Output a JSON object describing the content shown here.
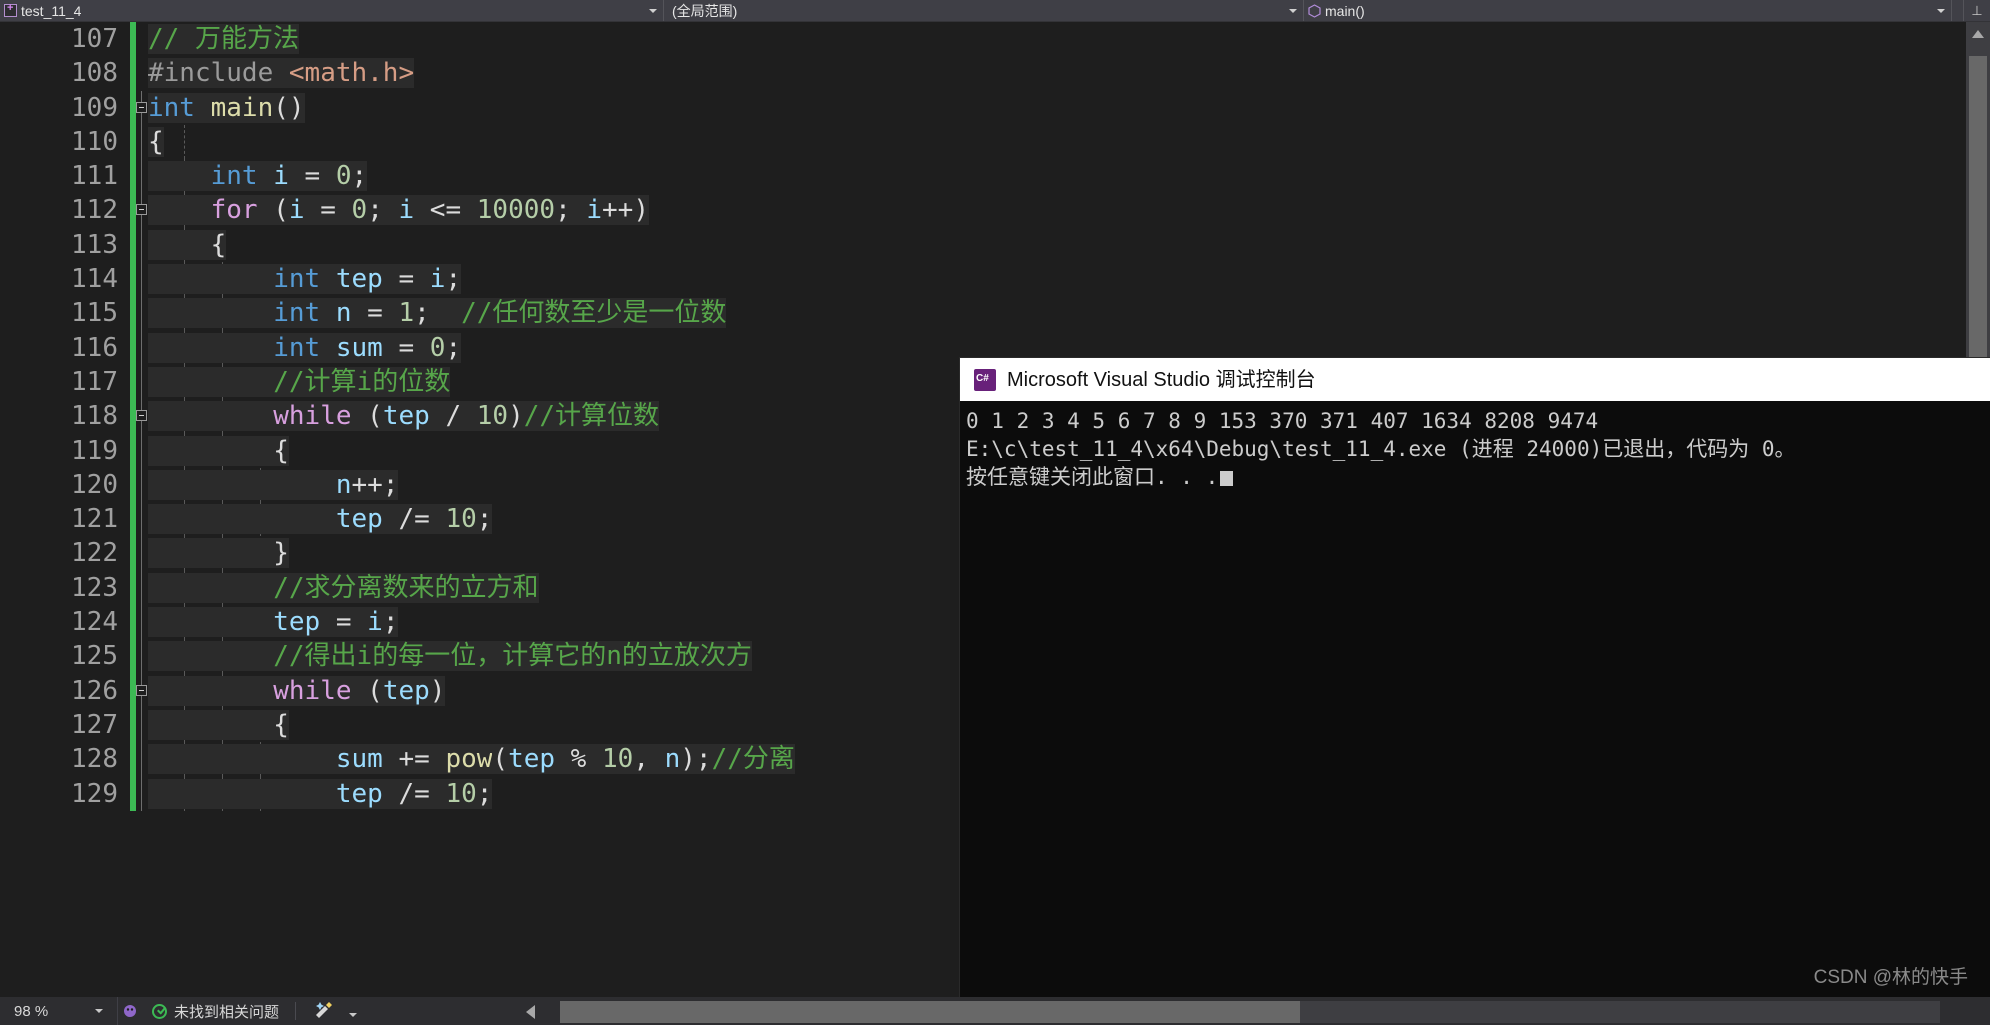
{
  "navbar": {
    "project_combo": {
      "label": "test_11_4",
      "icon": "file-cs-icon"
    },
    "scope_combo": {
      "label": "(全局范围)"
    },
    "member_combo": {
      "label": "main()",
      "icon": "method-icon"
    },
    "split_icon": "split-window-down-icon"
  },
  "editor": {
    "first_line_number": 107,
    "lines": [
      {
        "num": "107",
        "fold": "none",
        "tokens": [
          {
            "t": "// 万能方法",
            "c": "t-com"
          }
        ]
      },
      {
        "num": "108",
        "fold": "none",
        "tokens": [
          {
            "t": "#include ",
            "c": "t-pre"
          },
          {
            "t": "<math.h>",
            "c": "t-str"
          }
        ]
      },
      {
        "num": "109",
        "fold": "minus",
        "tokens": [
          {
            "t": "int ",
            "c": "t-key"
          },
          {
            "t": "main",
            "c": "t-fn"
          },
          {
            "t": "()",
            "c": "t-pln"
          }
        ]
      },
      {
        "num": "110",
        "fold": "none",
        "tokens": [
          {
            "t": "{",
            "c": "t-pln"
          }
        ]
      },
      {
        "num": "111",
        "fold": "none",
        "tokens": [
          {
            "t": "    ",
            "c": "t-pln"
          },
          {
            "t": "int ",
            "c": "t-key"
          },
          {
            "t": "i",
            "c": "t-var"
          },
          {
            "t": " = ",
            "c": "t-pln"
          },
          {
            "t": "0",
            "c": "t-num"
          },
          {
            "t": ";",
            "c": "t-pln"
          }
        ]
      },
      {
        "num": "112",
        "fold": "minus",
        "tokens": [
          {
            "t": "    ",
            "c": "t-pln"
          },
          {
            "t": "for",
            "c": "t-ctl"
          },
          {
            "t": " (",
            "c": "t-pln"
          },
          {
            "t": "i",
            "c": "t-var"
          },
          {
            "t": " = ",
            "c": "t-pln"
          },
          {
            "t": "0",
            "c": "t-num"
          },
          {
            "t": "; ",
            "c": "t-pln"
          },
          {
            "t": "i",
            "c": "t-var"
          },
          {
            "t": " <= ",
            "c": "t-pln"
          },
          {
            "t": "10000",
            "c": "t-num"
          },
          {
            "t": "; ",
            "c": "t-pln"
          },
          {
            "t": "i",
            "c": "t-var"
          },
          {
            "t": "++)",
            "c": "t-pln"
          }
        ]
      },
      {
        "num": "113",
        "fold": "none",
        "tokens": [
          {
            "t": "    {",
            "c": "t-pln"
          }
        ]
      },
      {
        "num": "114",
        "fold": "none",
        "tokens": [
          {
            "t": "        ",
            "c": "t-pln"
          },
          {
            "t": "int ",
            "c": "t-key"
          },
          {
            "t": "tep",
            "c": "t-var"
          },
          {
            "t": " = ",
            "c": "t-pln"
          },
          {
            "t": "i",
            "c": "t-var"
          },
          {
            "t": ";",
            "c": "t-pln"
          }
        ]
      },
      {
        "num": "115",
        "fold": "none",
        "tokens": [
          {
            "t": "        ",
            "c": "t-pln"
          },
          {
            "t": "int ",
            "c": "t-key"
          },
          {
            "t": "n",
            "c": "t-var"
          },
          {
            "t": " = ",
            "c": "t-pln"
          },
          {
            "t": "1",
            "c": "t-num"
          },
          {
            "t": ";  ",
            "c": "t-pln"
          },
          {
            "t": "//任何数至少是一位数",
            "c": "t-com"
          }
        ]
      },
      {
        "num": "116",
        "fold": "none",
        "tokens": [
          {
            "t": "        ",
            "c": "t-pln"
          },
          {
            "t": "int ",
            "c": "t-key"
          },
          {
            "t": "sum",
            "c": "t-var"
          },
          {
            "t": " = ",
            "c": "t-pln"
          },
          {
            "t": "0",
            "c": "t-num"
          },
          {
            "t": ";",
            "c": "t-pln"
          }
        ]
      },
      {
        "num": "117",
        "fold": "none",
        "tokens": [
          {
            "t": "        ",
            "c": "t-pln"
          },
          {
            "t": "//计算i的位数",
            "c": "t-com"
          }
        ]
      },
      {
        "num": "118",
        "fold": "minus",
        "tokens": [
          {
            "t": "        ",
            "c": "t-pln"
          },
          {
            "t": "while",
            "c": "t-ctl"
          },
          {
            "t": " (",
            "c": "t-pln"
          },
          {
            "t": "tep",
            "c": "t-var"
          },
          {
            "t": " / ",
            "c": "t-pln"
          },
          {
            "t": "10",
            "c": "t-num"
          },
          {
            "t": ")",
            "c": "t-pln"
          },
          {
            "t": "//计算位数",
            "c": "t-com"
          }
        ]
      },
      {
        "num": "119",
        "fold": "none",
        "tokens": [
          {
            "t": "        {",
            "c": "t-pln"
          }
        ]
      },
      {
        "num": "120",
        "fold": "none",
        "tokens": [
          {
            "t": "            ",
            "c": "t-pln"
          },
          {
            "t": "n",
            "c": "t-var"
          },
          {
            "t": "++;",
            "c": "t-pln"
          }
        ]
      },
      {
        "num": "121",
        "fold": "none",
        "tokens": [
          {
            "t": "            ",
            "c": "t-pln"
          },
          {
            "t": "tep",
            "c": "t-var"
          },
          {
            "t": " /= ",
            "c": "t-pln"
          },
          {
            "t": "10",
            "c": "t-num"
          },
          {
            "t": ";",
            "c": "t-pln"
          }
        ]
      },
      {
        "num": "122",
        "fold": "none",
        "tokens": [
          {
            "t": "        }",
            "c": "t-pln"
          }
        ]
      },
      {
        "num": "123",
        "fold": "none",
        "tokens": [
          {
            "t": "        ",
            "c": "t-pln"
          },
          {
            "t": "//求分离数来的立方和",
            "c": "t-com"
          }
        ]
      },
      {
        "num": "124",
        "fold": "none",
        "tokens": [
          {
            "t": "        ",
            "c": "t-pln"
          },
          {
            "t": "tep",
            "c": "t-var"
          },
          {
            "t": " = ",
            "c": "t-pln"
          },
          {
            "t": "i",
            "c": "t-var"
          },
          {
            "t": ";",
            "c": "t-pln"
          }
        ]
      },
      {
        "num": "125",
        "fold": "none",
        "tokens": [
          {
            "t": "        ",
            "c": "t-pln"
          },
          {
            "t": "//得出i的每一位，计算它的n的立放次方",
            "c": "t-com"
          }
        ]
      },
      {
        "num": "126",
        "fold": "minus",
        "tokens": [
          {
            "t": "        ",
            "c": "t-pln"
          },
          {
            "t": "while",
            "c": "t-ctl"
          },
          {
            "t": " (",
            "c": "t-pln"
          },
          {
            "t": "tep",
            "c": "t-var"
          },
          {
            "t": ")",
            "c": "t-pln"
          }
        ]
      },
      {
        "num": "127",
        "fold": "none",
        "tokens": [
          {
            "t": "        {",
            "c": "t-pln"
          }
        ]
      },
      {
        "num": "128",
        "fold": "none",
        "tokens": [
          {
            "t": "            ",
            "c": "t-pln"
          },
          {
            "t": "sum",
            "c": "t-var"
          },
          {
            "t": " += ",
            "c": "t-pln"
          },
          {
            "t": "pow",
            "c": "t-fn"
          },
          {
            "t": "(",
            "c": "t-pln"
          },
          {
            "t": "tep",
            "c": "t-var"
          },
          {
            "t": " % ",
            "c": "t-pln"
          },
          {
            "t": "10",
            "c": "t-num"
          },
          {
            "t": ", ",
            "c": "t-pln"
          },
          {
            "t": "n",
            "c": "t-var"
          },
          {
            "t": ");",
            "c": "t-pln"
          },
          {
            "t": "//分离",
            "c": "t-com"
          }
        ]
      },
      {
        "num": "129",
        "fold": "none",
        "tokens": [
          {
            "t": "            ",
            "c": "t-pln"
          },
          {
            "t": "tep",
            "c": "t-var"
          },
          {
            "t": " /= ",
            "c": "t-pln"
          },
          {
            "t": "10",
            "c": "t-num"
          },
          {
            "t": ";",
            "c": "t-pln"
          }
        ]
      }
    ]
  },
  "console": {
    "title": "Microsoft Visual Studio 调试控制台",
    "icon": "visual-studio-console-icon",
    "lines": [
      "0 1 2 3 4 5 6 7 8 9 153 370 371 407 1634 8208 9474",
      "E:\\c\\test_11_4\\x64\\Debug\\test_11_4.exe (进程 24000)已退出，代码为 0。",
      "按任意键关闭此窗口. . ."
    ]
  },
  "statusbar": {
    "zoom_level": "98 %",
    "error_icon": "bug-icon",
    "issue_status": "未找到相关问题",
    "brush_icon": "brush-icon"
  },
  "watermark": {
    "text": "CSDN @林的快手"
  },
  "colors": {
    "editor_bg": "#1e1e1e",
    "line_bg": "#2b2b2b",
    "comment": "#57a64a",
    "keyword": "#569cd6",
    "control": "#d8a0df",
    "number": "#b5cea8",
    "variable": "#9cdcfe",
    "function": "#dcdcaa",
    "string": "#d69d85",
    "change_bar": "#3cba54",
    "console_bg": "#0c0c0c",
    "console_title_bg": "#ffffff"
  }
}
